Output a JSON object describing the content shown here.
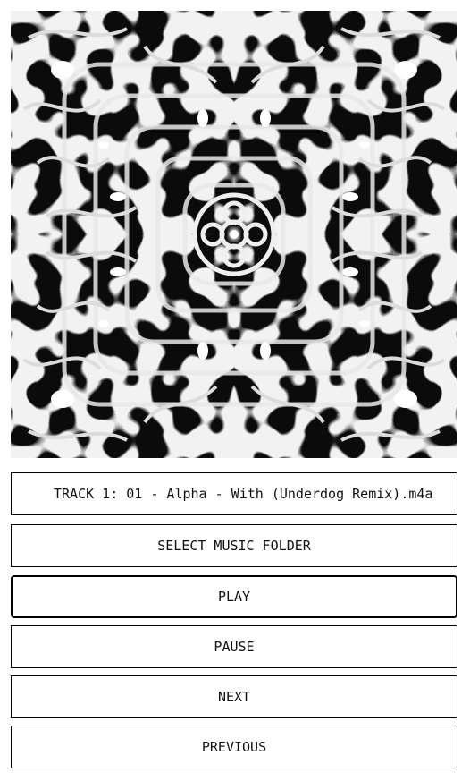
{
  "now_playing": {
    "text": "TRACK 1: 01 - Alpha - With (Underdog Remix).m4a"
  },
  "buttons": {
    "select_folder": "SELECT MUSIC FOLDER",
    "play": "PLAY",
    "pause": "PAUSE",
    "next": "NEXT",
    "previous": "PREVIOUS"
  },
  "visualizer": {
    "pattern": "black-and-white symmetric reaction-diffusion (labyrinth) pattern",
    "colors": {
      "dark": "#0b0b0b",
      "light": "#ffffff"
    }
  }
}
